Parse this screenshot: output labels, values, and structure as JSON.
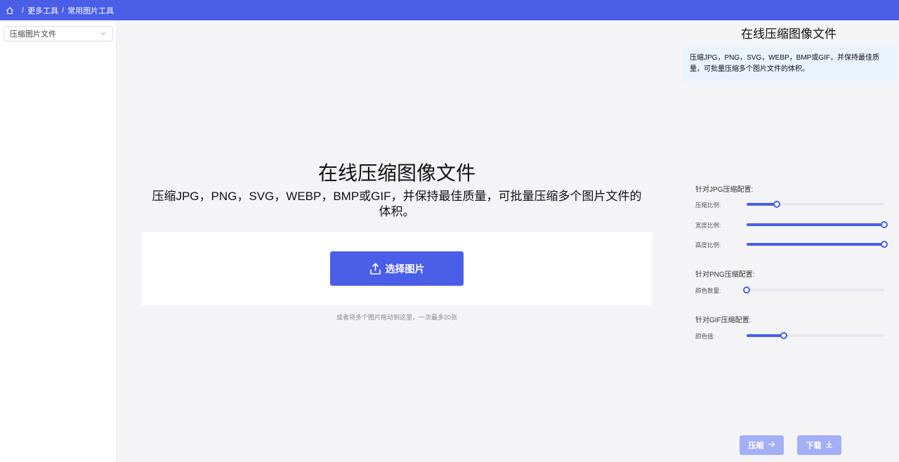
{
  "breadcrumb": {
    "items": [
      "更多工具",
      "常用图片工具"
    ],
    "separator": "/"
  },
  "sidebar": {
    "select_value": "压缩图片文件"
  },
  "main": {
    "title": "在线压缩图像文件",
    "description": "压缩JPG，PNG，SVG，WEBP，BMP或GIF，并保持最佳质量，可批量压缩多个图片文件的体积。",
    "upload_button": "选择图片",
    "drop_hint": "或者将多个图片拖动到这里，一次最多20张"
  },
  "panel": {
    "title": "在线压缩图像文件",
    "info": "压缩JPG，PNG，SVG，WEBP，BMP或GIF，并保持最佳质量，可批量压缩多个图片文件的体积。",
    "jpg": {
      "title": "针对JPG压缩配置:",
      "compress_label": "压缩比例:",
      "compress_value": 0.22,
      "width_label": "宽度比例:",
      "width_value": 1.0,
      "height_label": "高度比例:",
      "height_value": 1.0
    },
    "png": {
      "title": "针对PNG压缩配置:",
      "colors_label": "颜色数量:",
      "colors_value": 0.0
    },
    "gif": {
      "title": "针对GIF压缩配置:",
      "colors_label": "颜色值:",
      "colors_value": 0.27
    },
    "compress_button": "压缩",
    "download_button": "下载"
  },
  "colors": {
    "accent": "#4a5ee8",
    "disabled_button": "#a3b0f6",
    "info_bg": "#e9f2fd"
  }
}
